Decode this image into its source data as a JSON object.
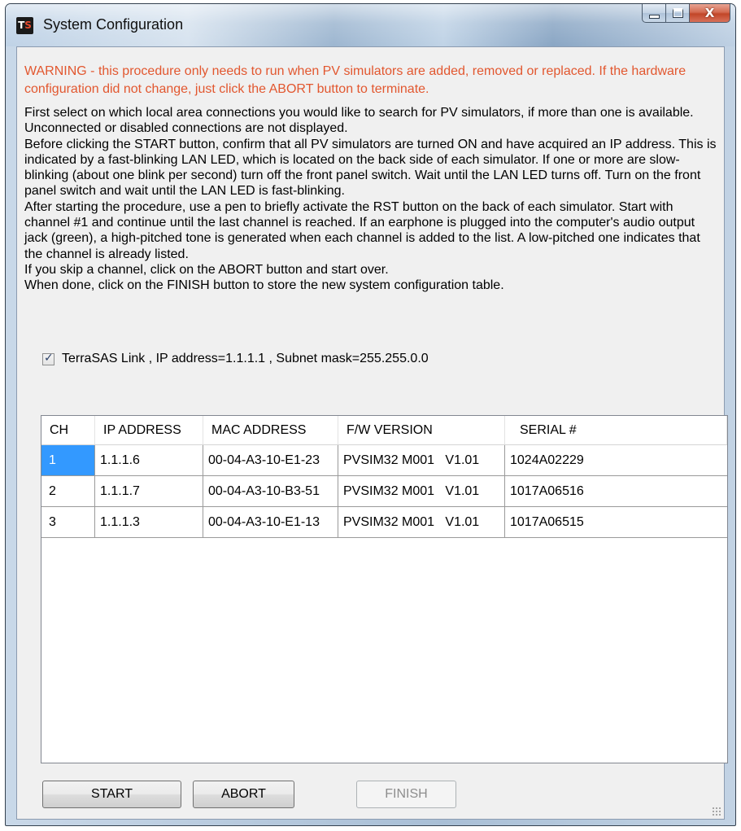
{
  "window": {
    "title": "System Configuration",
    "icon_label": "TS"
  },
  "caption_buttons": {
    "minimize": "minimize-icon",
    "maximize": "maximize-icon",
    "close": "close-icon",
    "close_glyph": "X"
  },
  "warning": "WARNING - this procedure only needs to run when PV simulators are added, removed or replaced. If the hardware configuration did not change, just click the ABORT button to terminate.",
  "instructions": [
    "First select on which local area connections you would like to search for PV simulators, if more than one is available. Unconnected or disabled connections are not displayed.",
    "Before clicking the START button, confirm that all PV simulators are turned ON and have acquired an IP address. This is indicated by a fast-blinking LAN LED, which is located on the back side of each simulator. If one or more are slow-blinking (about one blink per second) turn off the front panel switch. Wait until the LAN LED turns off. Turn on the front panel switch and wait until the LAN LED is fast-blinking.",
    "After starting the procedure, use a pen to briefly activate the RST button on the back of each simulator. Start with channel #1 and continue until the last channel is reached. If an earphone is plugged into the computer's audio output jack (green), a high-pitched tone is generated when each channel is added to the list. A low-pitched one indicates that the channel is already listed.",
    "If you skip a channel, click on the ABORT button and start over.",
    "When done, click on the FINISH button to store the new system configuration table."
  ],
  "connection": {
    "checked": true,
    "label": "TerraSAS Link , IP address=1.1.1.1 , Subnet mask=255.255.0.0"
  },
  "table": {
    "headers": [
      "CH",
      "IP ADDRESS",
      "MAC ADDRESS",
      "F/W VERSION",
      "SERIAL #"
    ],
    "rows": [
      [
        "1",
        "1.1.1.6",
        "00-04-A3-10-E1-23",
        "PVSIM32 M001   V1.01",
        "1024A02229"
      ],
      [
        "2",
        "1.1.1.7",
        "00-04-A3-10-B3-51",
        "PVSIM32 M001   V1.01",
        "1017A06516"
      ],
      [
        "3",
        "1.1.1.3",
        "00-04-A3-10-E1-13",
        "PVSIM32 M001   V1.01",
        "1017A06515"
      ]
    ],
    "selected_row": 0
  },
  "buttons": {
    "start": "START",
    "abort": "ABORT",
    "finish": "FINISH"
  }
}
